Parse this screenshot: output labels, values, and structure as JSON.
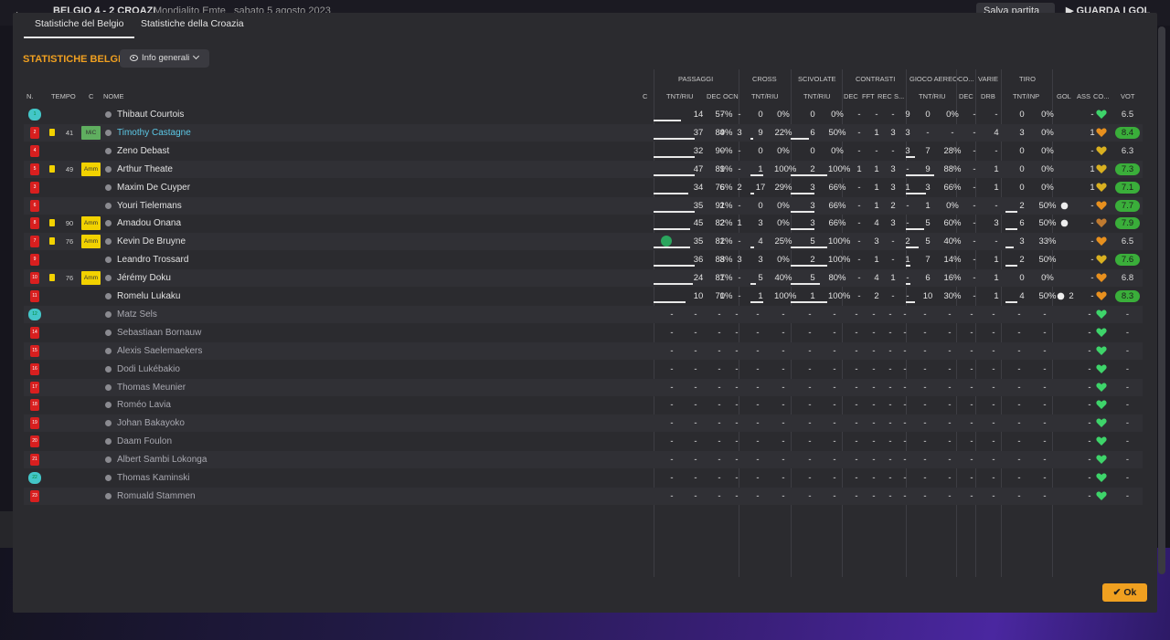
{
  "topbar": {
    "match": "BELGIO 4 - 2 CROAZI",
    "venue": "Mondialito Emte",
    "date": "sabato 5 agosto 2023",
    "save": "Salva partita",
    "watch": "GUARDA I GOL"
  },
  "tabs": [
    "Statistiche del Belgio",
    "Statistiche della Croazia"
  ],
  "section_title": "STATISTICHE BELGIO",
  "dropdown": "Info generali",
  "headers": {
    "groups": {
      "passaggi": "PASSAGGI",
      "cross": "CROSS",
      "scivolate": "SCIVOLATE",
      "contrasti": "CONTRASTI",
      "gioco_aereo": "GIOCO AEREO",
      "co": "CO...",
      "varie": "VARIE",
      "tiro": "TIRO"
    },
    "cols": {
      "n": "N.",
      "tempo": "TEMPO",
      "c": "C",
      "nome": "NOME",
      "c2": "C",
      "tnt_riu": "TNT/RIU",
      "dec": "DEC",
      "ocn": "OCN",
      "fft": "FFT",
      "rec": "REC",
      "s": "S...",
      "drb": "DRB",
      "tnt_inp": "TNT/INP",
      "gol": "GOL",
      "ass": "ASS",
      "co2": "CO...",
      "vot": "VOT"
    }
  },
  "players": [
    {
      "num": "1",
      "gk": true,
      "name": "Thibaut Courtois",
      "card": false,
      "tempo": "",
      "role": "",
      "pass": [
        "14",
        "57%",
        "-",
        "-"
      ],
      "cross": [
        "0",
        "0%"
      ],
      "sciv": [
        "0",
        "0%"
      ],
      "contr": [
        "-",
        "-",
        "-",
        "9"
      ],
      "aereo": [
        "0",
        "0%"
      ],
      "co": "-",
      "drb": "-",
      "tiro": [
        "0",
        "0%"
      ],
      "gol": "",
      "ass": "-",
      "heart": "green",
      "vote": "6.5",
      "vgreen": false,
      "u": [
        0.6,
        0,
        0,
        0,
        0,
        0
      ]
    },
    {
      "num": "2",
      "gk": false,
      "name": "Timothy Castagne",
      "link": true,
      "card": true,
      "tempo": "41",
      "role": "MiC",
      "rolecolor": "#5fae5f",
      "pass": [
        "37",
        "89%",
        "4",
        "3"
      ],
      "cross": [
        "9",
        "22%"
      ],
      "sciv": [
        "6",
        "50%"
      ],
      "contr": [
        "-",
        "1",
        "3",
        "3"
      ],
      "aereo": [
        "-",
        "-"
      ],
      "co": "-",
      "drb": "4",
      "tiro": [
        "3",
        "0%"
      ],
      "gol": "",
      "ass": "1",
      "heart": "orange",
      "vote": "8.4",
      "vgreen": true,
      "u": [
        0.9,
        0.2,
        0.5,
        0,
        0,
        0
      ]
    },
    {
      "num": "4",
      "gk": false,
      "name": "Zeno Debast",
      "card": false,
      "tempo": "",
      "role": "",
      "pass": [
        "32",
        "90%",
        "-",
        "-"
      ],
      "cross": [
        "0",
        "0%"
      ],
      "sciv": [
        "0",
        "0%"
      ],
      "contr": [
        "-",
        "-",
        "-",
        "3"
      ],
      "aereo": [
        "7",
        "28%"
      ],
      "co": "-",
      "drb": "-",
      "tiro": [
        "0",
        "0%"
      ],
      "gol": "",
      "ass": "-",
      "heart": "gold",
      "vote": "6.3",
      "vgreen": false,
      "u": [
        0.9,
        0,
        0,
        0,
        0.3,
        0
      ]
    },
    {
      "num": "5",
      "gk": false,
      "name": "Arthur Theate",
      "card": true,
      "tempo": "49",
      "role": "Amm",
      "rolecolor": "#f2d200",
      "pass": [
        "47",
        "89%",
        "1",
        "-"
      ],
      "cross": [
        "1",
        "100%"
      ],
      "sciv": [
        "2",
        "100%"
      ],
      "contr": [
        "1",
        "1",
        "3",
        "-"
      ],
      "aereo": [
        "9",
        "88%"
      ],
      "co": "-",
      "drb": "1",
      "tiro": [
        "0",
        "0%"
      ],
      "gol": "",
      "ass": "1",
      "heart": "gold",
      "vote": "7.3",
      "vgreen": true,
      "u": [
        0.9,
        1,
        1,
        0,
        0.9,
        0
      ]
    },
    {
      "num": "3",
      "gk": false,
      "name": "Maxim De Cuyper",
      "card": false,
      "tempo": "",
      "role": "",
      "pass": [
        "34",
        "76%",
        "6",
        "2"
      ],
      "cross": [
        "17",
        "29%"
      ],
      "sciv": [
        "3",
        "66%"
      ],
      "contr": [
        "-",
        "1",
        "3",
        "1"
      ],
      "aereo": [
        "3",
        "66%"
      ],
      "co": "-",
      "drb": "1",
      "tiro": [
        "0",
        "0%"
      ],
      "gol": "",
      "ass": "1",
      "heart": "gold",
      "vote": "7.1",
      "vgreen": true,
      "u": [
        0.75,
        0.3,
        0.65,
        0,
        0.65,
        0
      ]
    },
    {
      "num": "6",
      "gk": false,
      "name": "Youri Tielemans",
      "card": false,
      "tempo": "",
      "role": "",
      "pass": [
        "35",
        "91%",
        "2",
        "-"
      ],
      "cross": [
        "0",
        "0%"
      ],
      "sciv": [
        "3",
        "66%"
      ],
      "contr": [
        "-",
        "1",
        "2",
        "-"
      ],
      "aereo": [
        "1",
        "0%"
      ],
      "co": "-",
      "drb": "-",
      "tiro": [
        "2",
        "50%"
      ],
      "gol": "goal",
      "ass": "-",
      "heart": "orange",
      "vote": "7.7",
      "vgreen": true,
      "u": [
        0.9,
        0,
        0.65,
        0,
        0,
        0.5
      ]
    },
    {
      "num": "8",
      "gk": false,
      "name": "Amadou Onana",
      "card": true,
      "tempo": "90",
      "role": "Amm",
      "rolecolor": "#f2d200",
      "pass": [
        "45",
        "82%",
        "2",
        "1"
      ],
      "cross": [
        "3",
        "0%"
      ],
      "sciv": [
        "3",
        "66%"
      ],
      "contr": [
        "-",
        "4",
        "3",
        "-"
      ],
      "aereo": [
        "5",
        "60%"
      ],
      "co": "-",
      "drb": "3",
      "tiro": [
        "6",
        "50%"
      ],
      "gol": "goal",
      "ass": "-",
      "heart": "brown",
      "vote": "7.9",
      "vgreen": true,
      "u": [
        0.8,
        0,
        0.65,
        0,
        0.6,
        0.5
      ]
    },
    {
      "num": "7",
      "gk": false,
      "name": "Kevin De Bruyne",
      "card": true,
      "tempo": "76",
      "role": "Amm",
      "rolecolor": "#f2d200",
      "captain": true,
      "pass": [
        "35",
        "82%",
        "1",
        "-"
      ],
      "cross": [
        "4",
        "25%"
      ],
      "sciv": [
        "5",
        "100%"
      ],
      "contr": [
        "-",
        "3",
        "-",
        "2"
      ],
      "aereo": [
        "5",
        "40%"
      ],
      "co": "-",
      "drb": "-",
      "tiro": [
        "3",
        "33%"
      ],
      "gol": "",
      "ass": "-",
      "heart": "orange",
      "vote": "6.5",
      "vgreen": false,
      "u": [
        0.8,
        0.25,
        1,
        0,
        0.4,
        0.33
      ]
    },
    {
      "num": "9",
      "gk": false,
      "name": "Leandro Trossard",
      "card": false,
      "tempo": "",
      "role": "",
      "pass": [
        "36",
        "88%",
        "3",
        "3"
      ],
      "cross": [
        "3",
        "0%"
      ],
      "sciv": [
        "2",
        "100%"
      ],
      "contr": [
        "-",
        "1",
        "-",
        "1"
      ],
      "aereo": [
        "7",
        "14%"
      ],
      "co": "-",
      "drb": "1",
      "tiro": [
        "2",
        "50%"
      ],
      "gol": "",
      "ass": "-",
      "heart": "gold",
      "vote": "7.6",
      "vgreen": true,
      "u": [
        0.9,
        0,
        1,
        0,
        0.15,
        0.5
      ]
    },
    {
      "num": "10",
      "gk": false,
      "name": "Jérémy Doku",
      "card": true,
      "tempo": "76",
      "role": "Amm",
      "rolecolor": "#f2d200",
      "pass": [
        "24",
        "87%",
        "1",
        "-"
      ],
      "cross": [
        "5",
        "40%"
      ],
      "sciv": [
        "5",
        "80%"
      ],
      "contr": [
        "-",
        "4",
        "1",
        "-"
      ],
      "aereo": [
        "6",
        "16%"
      ],
      "co": "-",
      "drb": "1",
      "tiro": [
        "0",
        "0%"
      ],
      "gol": "",
      "ass": "-",
      "heart": "orange",
      "vote": "6.8",
      "vgreen": false,
      "u": [
        0.85,
        0.4,
        0.8,
        0,
        0.15,
        0
      ]
    },
    {
      "num": "11",
      "gk": false,
      "name": "Romelu Lukaku",
      "card": false,
      "tempo": "",
      "role": "",
      "pass": [
        "10",
        "70%",
        "1",
        "-"
      ],
      "cross": [
        "1",
        "100%"
      ],
      "sciv": [
        "1",
        "100%"
      ],
      "contr": [
        "-",
        "2",
        "-",
        "-"
      ],
      "aereo": [
        "10",
        "30%"
      ],
      "co": "-",
      "drb": "1",
      "tiro": [
        "4",
        "50%"
      ],
      "gol": "goal2",
      "ass": "-",
      "heart": "orange",
      "vote": "8.3",
      "vgreen": true,
      "u": [
        0.7,
        1,
        1,
        0,
        0.3,
        0.5
      ]
    },
    {
      "num": "12",
      "gk": true,
      "sub": true,
      "name": "Matz Sels"
    },
    {
      "num": "14",
      "sub": true,
      "name": "Sebastiaan Bornauw"
    },
    {
      "num": "15",
      "sub": true,
      "name": "Alexis Saelemaekers"
    },
    {
      "num": "16",
      "sub": true,
      "name": "Dodi Lukébakio"
    },
    {
      "num": "17",
      "sub": true,
      "name": "Thomas Meunier"
    },
    {
      "num": "18",
      "sub": true,
      "name": "Roméo Lavia"
    },
    {
      "num": "19",
      "sub": true,
      "name": "Johan Bakayoko"
    },
    {
      "num": "20",
      "sub": true,
      "name": "Daam Foulon"
    },
    {
      "num": "21",
      "sub": true,
      "name": "Albert Sambi Lokonga"
    },
    {
      "num": "22",
      "gk": true,
      "sub": true,
      "name": "Thomas Kaminski"
    },
    {
      "num": "23",
      "sub": true,
      "name": "Romuald Stammen"
    }
  ],
  "goal_extra": "2",
  "ok_label": "Ok",
  "colors": {
    "accent": "#f0a020",
    "vote_green": "#3aae3a",
    "link": "#5cc8e6",
    "card": "#f2d200"
  }
}
